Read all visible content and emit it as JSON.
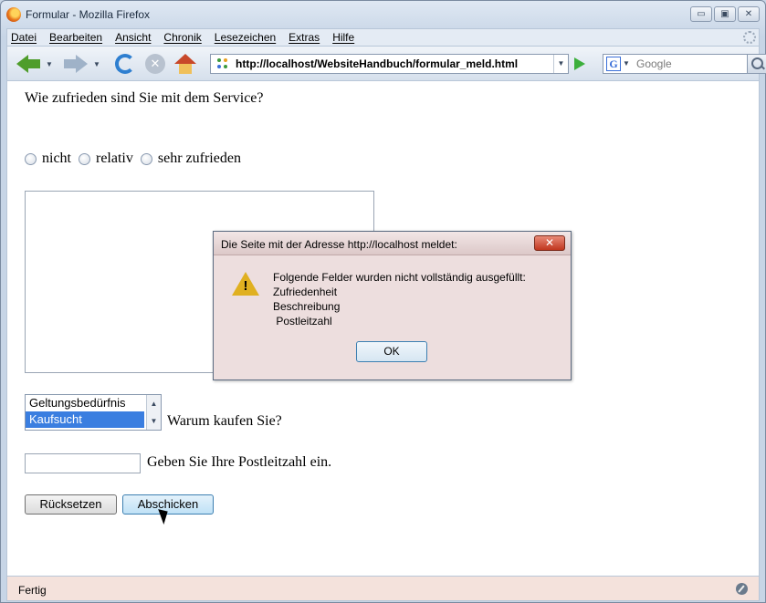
{
  "window": {
    "title": "Formular - Mozilla Firefox",
    "controls": {
      "minimize": "▭",
      "maximize": "▣",
      "close": "✕"
    }
  },
  "menu": [
    "Datei",
    "Bearbeiten",
    "Ansicht",
    "Chronik",
    "Lesezeichen",
    "Extras",
    "Hilfe"
  ],
  "navbar": {
    "url": "http://localhost/WebsiteHandbuch/formular_meld.html",
    "search_placeholder": "Google",
    "search_engine_letter": "G"
  },
  "form": {
    "question": "Wie zufrieden sind Sie mit dem Service?",
    "radio_options": [
      "nicht",
      "relativ",
      "sehr zufrieden"
    ],
    "listbox_options": [
      "Geltungsbedürfnis",
      "Kaufsucht"
    ],
    "listbox_selected_index": 1,
    "listbox_label": "Warum kaufen Sie?",
    "plz_label": "Geben Sie Ihre Postleitzahl ein.",
    "reset_label": "Rücksetzen",
    "submit_label": "Abschicken"
  },
  "dialog": {
    "title": "Die Seite mit der Adresse http://localhost meldet:",
    "close_label": "✕",
    "message_lines": [
      "Folgende Felder wurden nicht vollständig ausgefüllt:",
      "Zufriedenheit",
      "Beschreibung",
      " Postleitzahl"
    ],
    "ok_label": "OK",
    "warning_mark": "!"
  },
  "status": {
    "text": "Fertig"
  }
}
